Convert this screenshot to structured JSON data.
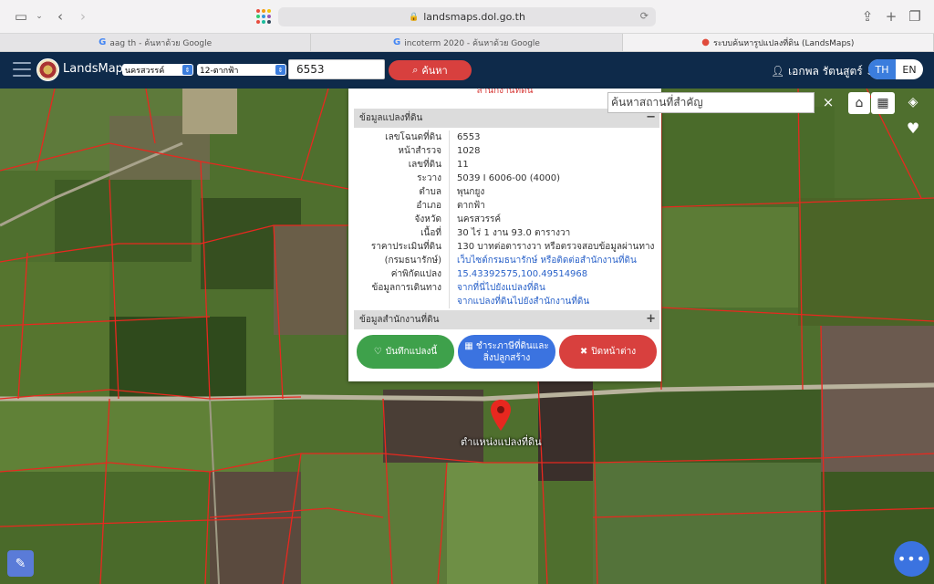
{
  "browser": {
    "url": "landsmaps.dol.go.th",
    "tabs": [
      {
        "label": "aag th - ค้นหาด้วย Google",
        "icon": "G"
      },
      {
        "label": "incoterm 2020 - ค้นหาด้วย Google",
        "icon": "G"
      },
      {
        "label": "ระบบค้นหารูปแปลงที่ดิน (LandsMaps)",
        "icon": "pin"
      }
    ]
  },
  "header": {
    "brand": "LandsMaps",
    "province_select": "นครสวรรค์",
    "district_select": "12-ตากฟ้า",
    "parcel_input": "6553",
    "search_label": "ค้นหา",
    "user_name": "เอกพล รัตนสูตร์",
    "lang_th": "TH",
    "lang_en": "EN"
  },
  "map_controls": {
    "place_search_placeholder": "ค้นหาสถานที่สำคัญ",
    "clear": "×",
    "fab": "•••"
  },
  "marker_label": "ตำแหน่งแปลงที่ดิน",
  "popup": {
    "office_title": "สำนักงานที่ดิน",
    "section_parcel": "ข้อมูลแปลงที่ดิน",
    "section_office": "ข้อมูลสำนักงานที่ดิน",
    "collapse": "−",
    "expand": "+",
    "rows": [
      {
        "label": "เลขโฉนดที่ดิน",
        "value": "6553"
      },
      {
        "label": "หน้าสำรวจ",
        "value": "1028"
      },
      {
        "label": "เลขที่ดิน",
        "value": "11"
      },
      {
        "label": "ระวาง",
        "value": "5039 I 6006-00 (4000)"
      },
      {
        "label": "ตำบล",
        "value": "พุนกยูง"
      },
      {
        "label": "อำเภอ",
        "value": "ตากฟ้า"
      },
      {
        "label": "จังหวัด",
        "value": "นครสวรรค์"
      },
      {
        "label": "เนื้อที่",
        "value": "30 ไร่ 1 งาน 93.0 ตารางวา"
      },
      {
        "label": "ราคาประเมินที่ดิน",
        "value": "130 บาทต่อตารางวา หรือตรวจสอบข้อมูลผ่านทาง"
      },
      {
        "label": "(กรมธนารักษ์)",
        "value": "เว็บไซต์กรมธนารักษ์ หรือติดต่อสำนักงานที่ดิน"
      },
      {
        "label": "ค่าพิกัดแปลง",
        "value": "15.43392575,100.49514968"
      },
      {
        "label": "ข้อมูลการเดินทาง",
        "value": "จากที่นี่ไปยังแปลงที่ดิน"
      },
      {
        "label": "",
        "value": "จากแปลงที่ดินไปยังสำนักงานที่ดิน"
      }
    ],
    "save_label": "บันทึกแปลงนี้",
    "tax_label_1": "ชำระภาษีที่ดินและ",
    "tax_label_2": "สิ่งปลูกสร้าง",
    "close_label": "ปิดหน้าต่าง"
  }
}
